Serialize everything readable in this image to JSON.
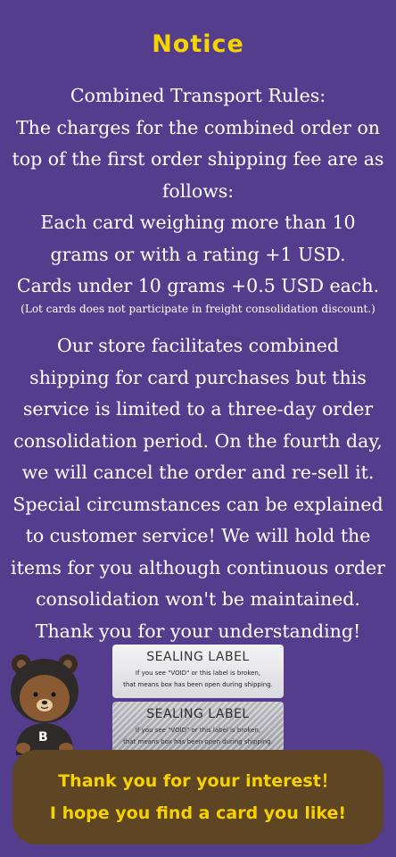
{
  "title": "Notice",
  "rules": {
    "lines": [
      "Combined Transport Rules:",
      "The charges for the combined order on",
      "top of the first order shipping fee are as",
      "follows:",
      "Each card weighing more than 10",
      "grams or with a rating +1 USD.",
      "Cards under 10 grams +0.5 USD each."
    ],
    "note": "(Lot cards does not participate in freight consolidation discount.)"
  },
  "policy": {
    "lines": [
      "Our store facilitates combined",
      "shipping for card purchases but this",
      "service is limited to a three-day order",
      "consolidation period. On the fourth day,",
      "we will cancel the order and re-sell it.",
      "Special circumstances can be explained",
      "to customer service! We will hold the",
      "items for you although continuous order",
      "consolidation won't be maintained.",
      "Thank you for your understanding!"
    ]
  },
  "labels": {
    "label1": {
      "title": "SEALING LABEL",
      "line1": "If you see \"VOID\" or this label is broken,",
      "line2": "that means box has been open during shipping."
    },
    "label2": {
      "title": "SEALING LABEL",
      "line1": "If you see \"VOID\" or this label is broken,",
      "line2": "that means box has been open during shipping."
    }
  },
  "mascot": {
    "letter": "B"
  },
  "banner": {
    "line1": "Thank you for your interest！",
    "line2": "I hope you find a card you like!"
  },
  "colors": {
    "background": "#553d8e",
    "title": "#f5d400",
    "banner_bg": "#5e4524",
    "banner_text": "#f7d200"
  }
}
